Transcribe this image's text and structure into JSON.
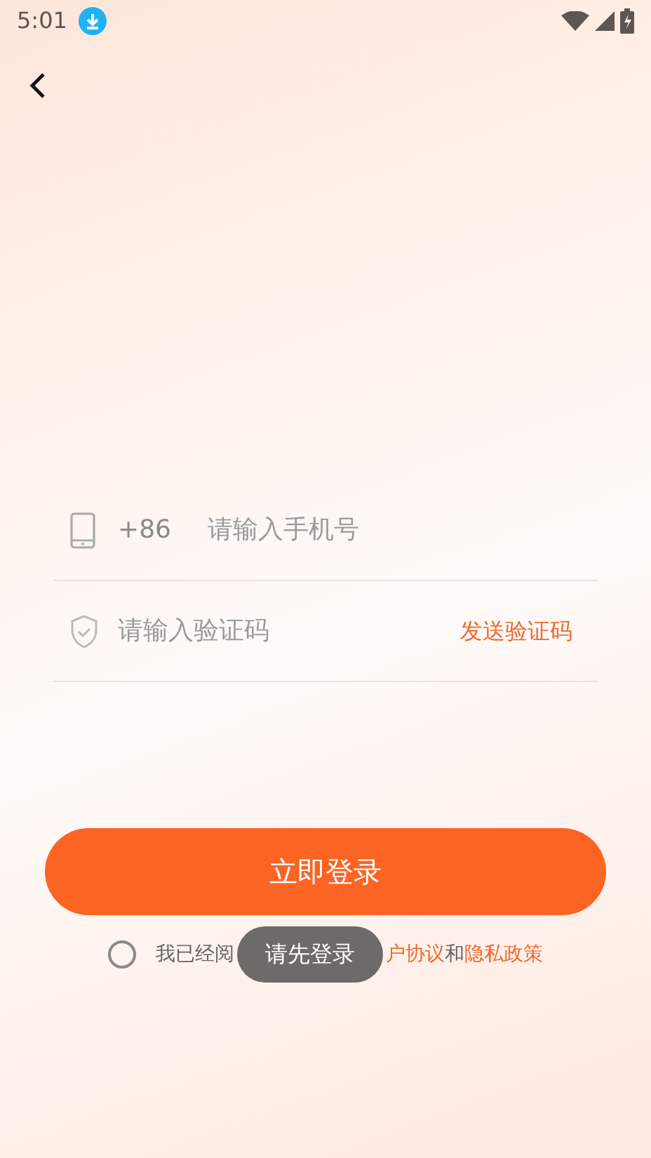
{
  "status_bar": {
    "time": "5:01"
  },
  "phone": {
    "prefix": "+86",
    "placeholder": "请输入手机号"
  },
  "code": {
    "placeholder": "请输入验证码",
    "send": "发送验证码"
  },
  "login_button": "立即登录",
  "agreement": {
    "checked": false,
    "prefix": "我已经阅",
    "user_agreement": "户协议",
    "conjunction": "和",
    "privacy_policy": "隐私政策"
  },
  "toast": "请先登录"
}
